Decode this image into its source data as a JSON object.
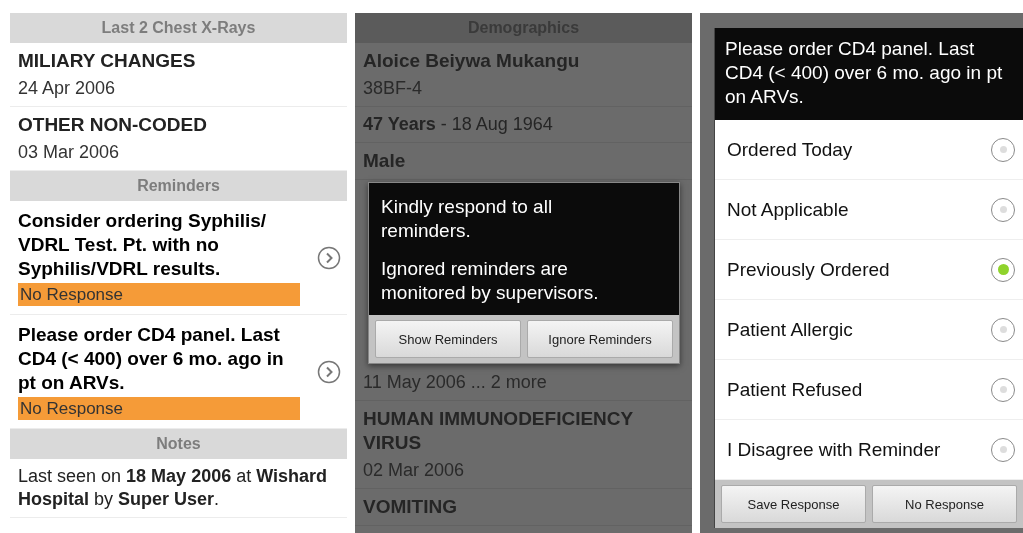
{
  "screens": [
    {
      "sections": [
        {
          "header": "Last 2 Chest X-Rays",
          "items": [
            {
              "kind": "entry",
              "title": "MILIARY CHANGES",
              "subtitle": "24 Apr 2006"
            },
            {
              "kind": "entry",
              "title": "OTHER NON-CODED",
              "subtitle": "03 Mar 2006"
            }
          ]
        },
        {
          "header": "Reminders",
          "items": [
            {
              "kind": "reminder",
              "title": "Consider ordering Syphilis/ VDRL Test. Pt. with no Syphilis/VDRL results.",
              "status": "No Response"
            },
            {
              "kind": "reminder",
              "title": "Please order CD4 panel. Last CD4 (< 400) over 6 mo. ago in pt on ARVs.",
              "status": "No Response"
            }
          ]
        },
        {
          "header": "Notes",
          "items": [
            {
              "kind": "note",
              "text": "Last seen on **18 May 2006** at **Wishard Hospital** by **Super User**."
            }
          ]
        }
      ]
    },
    {
      "sections": [
        {
          "header": "Demographics",
          "items": [
            {
              "kind": "entry",
              "title": "Aloice Beiywa Mukangu",
              "subtitle": "38BF-4"
            },
            {
              "kind": "note",
              "text": "**47 Years** - 18 Aug 1964"
            },
            {
              "kind": "entry",
              "title": "Male"
            }
          ]
        }
      ],
      "dialog": {
        "kind": "alert",
        "paragraphs": [
          "Kindly respond to all reminders.",
          "Ignored reminders are monitored by supervisors."
        ],
        "buttons": [
          "Show Reminders",
          "Ignore Reminders"
        ]
      },
      "after": [
        {
          "kind": "entry",
          "subtitle": "11 May 2006 ... 2 more"
        },
        {
          "kind": "entry",
          "title": "HUMAN IMMUNODEFICIENCY VIRUS",
          "subtitle": "02 Mar 2006"
        },
        {
          "kind": "entry",
          "title": "VOMITING"
        }
      ]
    },
    {
      "dialog": {
        "kind": "choice",
        "title": "Please order CD4 panel. Last CD4 (< 400) over 6 mo. ago in pt on ARVs.",
        "options": [
          {
            "label": "Ordered Today",
            "selected": false
          },
          {
            "label": "Not Applicable",
            "selected": false
          },
          {
            "label": "Previously Ordered",
            "selected": true
          },
          {
            "label": "Patient Allergic",
            "selected": false
          },
          {
            "label": "Patient Refused",
            "selected": false
          },
          {
            "label": "I Disagree with Reminder",
            "selected": false
          }
        ],
        "buttons": [
          "Save Response",
          "No Response"
        ]
      }
    }
  ]
}
